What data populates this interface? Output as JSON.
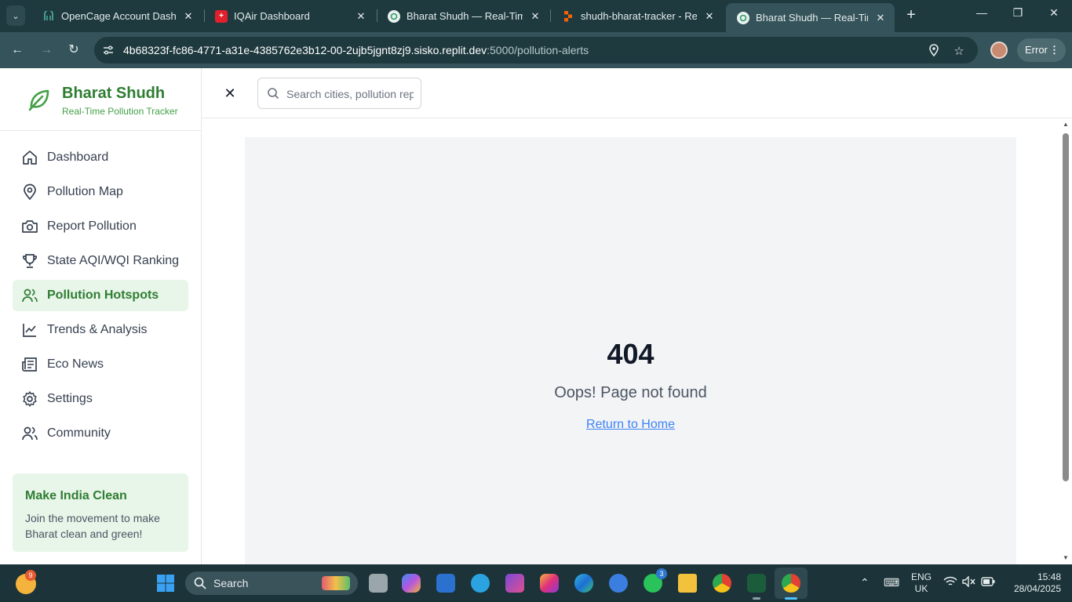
{
  "browser": {
    "tabs": [
      {
        "title": "OpenCage Account Dashboard",
        "active": false
      },
      {
        "title": "IQAir Dashboard",
        "active": false
      },
      {
        "title": "Bharat Shudh — Real-Time Pollution Tracker",
        "active": false
      },
      {
        "title": "shudh-bharat-tracker - Replit",
        "active": false
      },
      {
        "title": "Bharat Shudh — Real-Time Pollution Tracker",
        "active": true
      }
    ],
    "url_host": "4b68323f-fc86-4771-a31e-4385762e3b12-00-2ujb5jgnt8zj9.sisko.replit.dev",
    "url_rest": ":5000/pollution-alerts",
    "profile_status": "Error"
  },
  "sidebar": {
    "brand_title": "Bharat Shudh",
    "brand_subtitle": "Real-Time Pollution Tracker",
    "items": [
      {
        "label": "Dashboard",
        "icon": "home-icon",
        "active": false
      },
      {
        "label": "Pollution Map",
        "icon": "map-pin-icon",
        "active": false
      },
      {
        "label": "Report Pollution",
        "icon": "camera-icon",
        "active": false
      },
      {
        "label": "State AQI/WQI Ranking",
        "icon": "trophy-icon",
        "active": false
      },
      {
        "label": "Pollution Hotspots",
        "icon": "users-icon",
        "active": true
      },
      {
        "label": "Trends & Analysis",
        "icon": "chart-line-icon",
        "active": false
      },
      {
        "label": "Eco News",
        "icon": "newspaper-icon",
        "active": false
      },
      {
        "label": "Settings",
        "icon": "gear-icon",
        "active": false
      },
      {
        "label": "Community",
        "icon": "users-icon",
        "active": false
      }
    ],
    "promo": {
      "title": "Make India Clean",
      "text": "Join the movement to make Bharat clean and green!"
    }
  },
  "header": {
    "search_placeholder": "Search cities, pollution reports..."
  },
  "main": {
    "code": "404",
    "message": "Oops! Page not found",
    "link": "Return to Home"
  },
  "taskbar": {
    "weather_badge": "9",
    "search_label": "Search",
    "whatsapp_badge": "3",
    "lang_line1": "ENG",
    "lang_line2": "UK",
    "time": "15:48",
    "date": "28/04/2025"
  },
  "colors": {
    "brand_green": "#2e7d32",
    "active_bg": "#e8f5e9",
    "link_blue": "#3b82f6",
    "panel_bg": "#f3f4f6"
  }
}
